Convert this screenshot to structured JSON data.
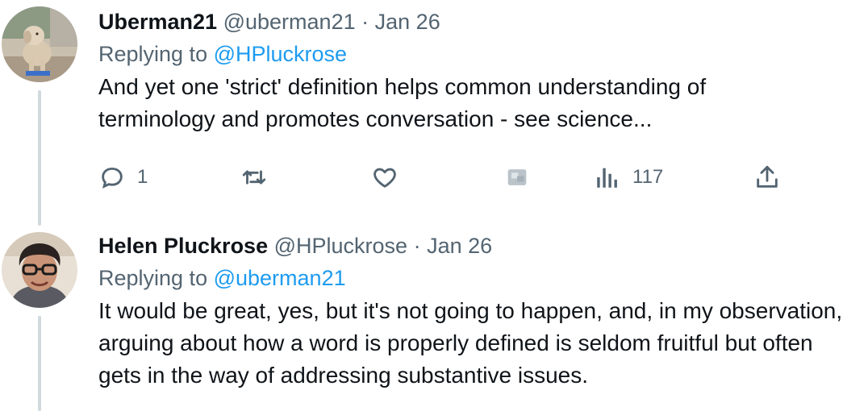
{
  "tweets": [
    {
      "author_name": "Uberman21",
      "handle": "@uberman21",
      "separator": "·",
      "date": "Jan 26",
      "replying_prefix": "Replying to ",
      "replying_to": "@HPluckrose",
      "text": "And yet one 'strict' definition helps common understanding of terminology and promotes conversation - see science...",
      "avatar_icon": "dog-avatar",
      "actions": {
        "reply_count": "1",
        "retweet_count": "",
        "like_count": "",
        "views_count": "117"
      }
    },
    {
      "author_name": "Helen Pluckrose",
      "handle": "@HPluckrose",
      "separator": "·",
      "date": "Jan 26",
      "replying_prefix": "Replying to ",
      "replying_to": "@uberman21",
      "text": "It would be great, yes, but it's not going to happen, and, in my observation, arguing about how a word is properly defined is seldom fruitful but often gets in the way of addressing substantive issues.",
      "avatar_icon": "person-with-glasses-avatar"
    }
  ],
  "colors": {
    "text": "#0f1419",
    "muted": "#536471",
    "link": "#1d9bf0",
    "thread_line": "#cfd9de"
  }
}
